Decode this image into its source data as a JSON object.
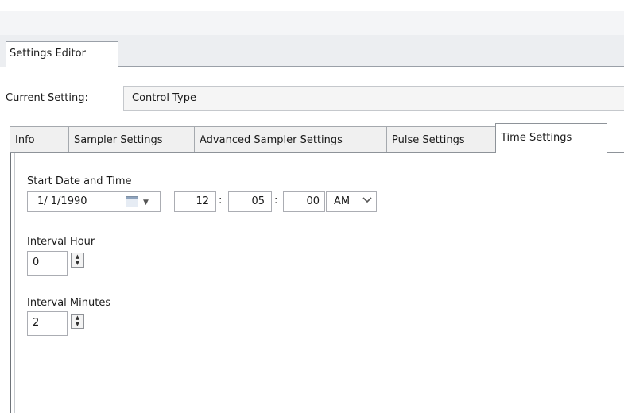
{
  "document_tab": {
    "label": "Settings Editor"
  },
  "current_setting": {
    "label": "Current Setting:",
    "value": "Control Type"
  },
  "tabs": [
    {
      "label": "Info"
    },
    {
      "label": "Sampler Settings"
    },
    {
      "label": "Advanced Sampler Settings"
    },
    {
      "label": "Pulse Settings"
    },
    {
      "label": "Time Settings",
      "active": true
    }
  ],
  "time_settings": {
    "start_label": "Start Date and Time",
    "date_value": "1/ 1/1990",
    "hour": "12",
    "minute": "05",
    "second": "00",
    "separator": ":",
    "ampm": "AM",
    "interval_hour_label": "Interval Hour",
    "interval_hour_value": "0",
    "interval_minutes_label": "Interval Minutes",
    "interval_minutes_value": "2"
  },
  "icons": {
    "calendar": "calendar-icon",
    "dropdown": "chevron-down-icon",
    "spin_up": "spin-up-icon",
    "spin_down": "spin-down-icon"
  }
}
